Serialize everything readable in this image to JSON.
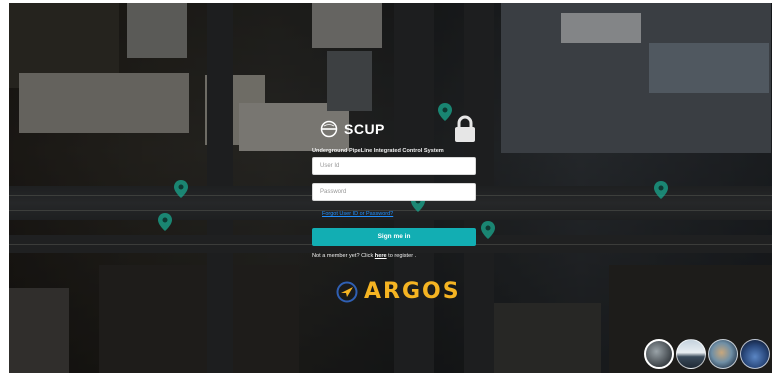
{
  "app": {
    "brand_name": "SCUP",
    "subtitle": "Underground PipeLine Integrated Control System"
  },
  "login": {
    "user_id_placeholder": "User Id",
    "password_placeholder": "Password",
    "forgot_link": "Forgot User ID or Password?",
    "sign_in_label": "Sign me in",
    "member_prefix": "Not a member yet? Click ",
    "member_link": "here",
    "member_suffix": " to register ."
  },
  "footer": {
    "logo_text": "ARGOS"
  },
  "background_thumbnails": [
    "satellite-city",
    "aurora-landscape",
    "globe",
    "space"
  ],
  "colors": {
    "accent": "#12aeb3",
    "link": "#1f8fff",
    "argos_gold": "#f5b422",
    "map_pin": "#1aa88f"
  }
}
